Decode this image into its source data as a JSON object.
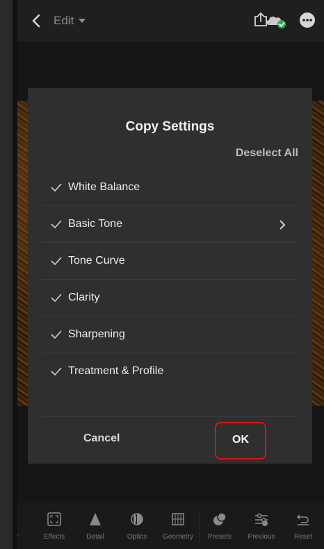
{
  "topbar": {
    "mode_label": "Edit"
  },
  "dialog": {
    "title": "Copy Settings",
    "deselect_all": "Deselect All",
    "items": [
      {
        "label": "White Balance",
        "checked": true,
        "has_submenu": false
      },
      {
        "label": "Basic Tone",
        "checked": true,
        "has_submenu": true
      },
      {
        "label": "Tone Curve",
        "checked": true,
        "has_submenu": false
      },
      {
        "label": "Clarity",
        "checked": true,
        "has_submenu": false
      },
      {
        "label": "Sharpening",
        "checked": true,
        "has_submenu": false
      },
      {
        "label": "Treatment & Profile",
        "checked": true,
        "has_submenu": false
      }
    ],
    "cancel_label": "Cancel",
    "ok_label": "OK"
  },
  "toolbar": {
    "items": [
      {
        "label": "r",
        "icon": "color-icon"
      },
      {
        "label": "Effects",
        "icon": "effects-icon"
      },
      {
        "label": "Detail",
        "icon": "detail-icon"
      },
      {
        "label": "Optics",
        "icon": "optics-icon"
      },
      {
        "label": "Geometry",
        "icon": "geometry-icon"
      },
      {
        "label": "Presets",
        "icon": "presets-icon"
      },
      {
        "label": "Previous",
        "icon": "previous-icon"
      },
      {
        "label": "Reset",
        "icon": "reset-icon"
      }
    ]
  },
  "colors": {
    "dialog_bg": "#2f2f2f",
    "highlight": "#e0101a",
    "sync_ok": "#2fa84f"
  }
}
